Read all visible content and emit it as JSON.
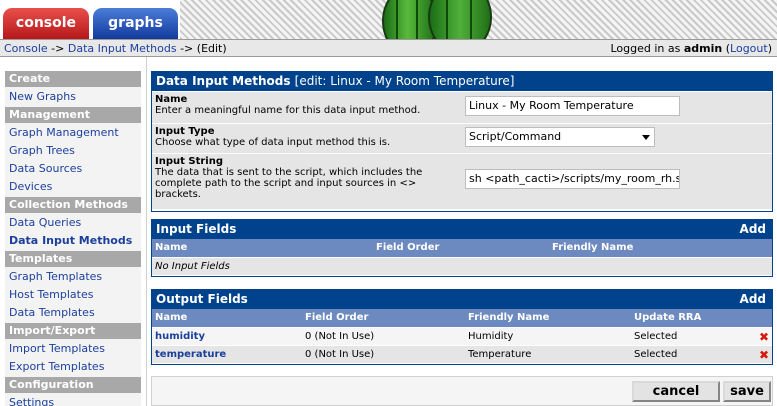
{
  "tabs": {
    "console": "console",
    "graphs": "graphs"
  },
  "breadcrumb": {
    "console": "Console",
    "sep1": " -> ",
    "data_input_methods": "Data Input Methods",
    "sep2": " -> ",
    "edit": "(Edit)"
  },
  "login": {
    "prefix": "Logged in as ",
    "user": "admin",
    "logout_open": " (",
    "logout": "Logout",
    "logout_close": ")"
  },
  "sidebar": {
    "sections": [
      {
        "header": "Create",
        "items": [
          "New Graphs"
        ]
      },
      {
        "header": "Management",
        "items": [
          "Graph Management",
          "Graph Trees",
          "Data Sources",
          "Devices"
        ]
      },
      {
        "header": "Collection Methods",
        "items": [
          "Data Queries",
          "Data Input Methods"
        ]
      },
      {
        "header": "Templates",
        "items": [
          "Graph Templates",
          "Host Templates",
          "Data Templates"
        ]
      },
      {
        "header": "Import/Export",
        "items": [
          "Import Templates",
          "Export Templates"
        ]
      },
      {
        "header": "Configuration",
        "items": [
          "Settings"
        ]
      }
    ]
  },
  "method_panel": {
    "title": "Data Input Methods",
    "subtitle": "[edit: Linux - My Room Temperature]",
    "name_label": "Name",
    "name_desc": "Enter a meaningful name for this data input method.",
    "name_value": "Linux - My Room Temperature",
    "type_label": "Input Type",
    "type_desc": "Choose what type of data input method this is.",
    "type_value": "Script/Command",
    "string_label": "Input String",
    "string_desc": "The data that is sent to the script, which includes the complete path to the script and input sources in <> brackets.",
    "string_value": "sh <path_cacti>/scripts/my_room_rh.sh"
  },
  "input_fields": {
    "title": "Input Fields",
    "add": "Add",
    "col_name": "Name",
    "col_order": "Field Order",
    "col_friendly": "Friendly Name",
    "empty": "No Input Fields"
  },
  "output_fields": {
    "title": "Output Fields",
    "add": "Add",
    "col_name": "Name",
    "col_order": "Field Order",
    "col_friendly": "Friendly Name",
    "col_rra": "Update RRA",
    "rows": [
      {
        "name": "humidity",
        "order": "0 (Not In Use)",
        "friendly": "Humidity",
        "rra": "Selected",
        "delete_icon": "delete-x-icon"
      },
      {
        "name": "temperature",
        "order": "0 (Not In Use)",
        "friendly": "Temperature",
        "rra": "Selected",
        "delete_icon": "delete-x-icon"
      }
    ]
  },
  "buttons": {
    "cancel": "cancel",
    "save": "save"
  },
  "colors": {
    "panel_header": "#00438c",
    "table_header": "#6c8abf",
    "link": "#1b3f9c",
    "console_tab": "#c8302c",
    "graphs_tab": "#2b5bbf"
  }
}
